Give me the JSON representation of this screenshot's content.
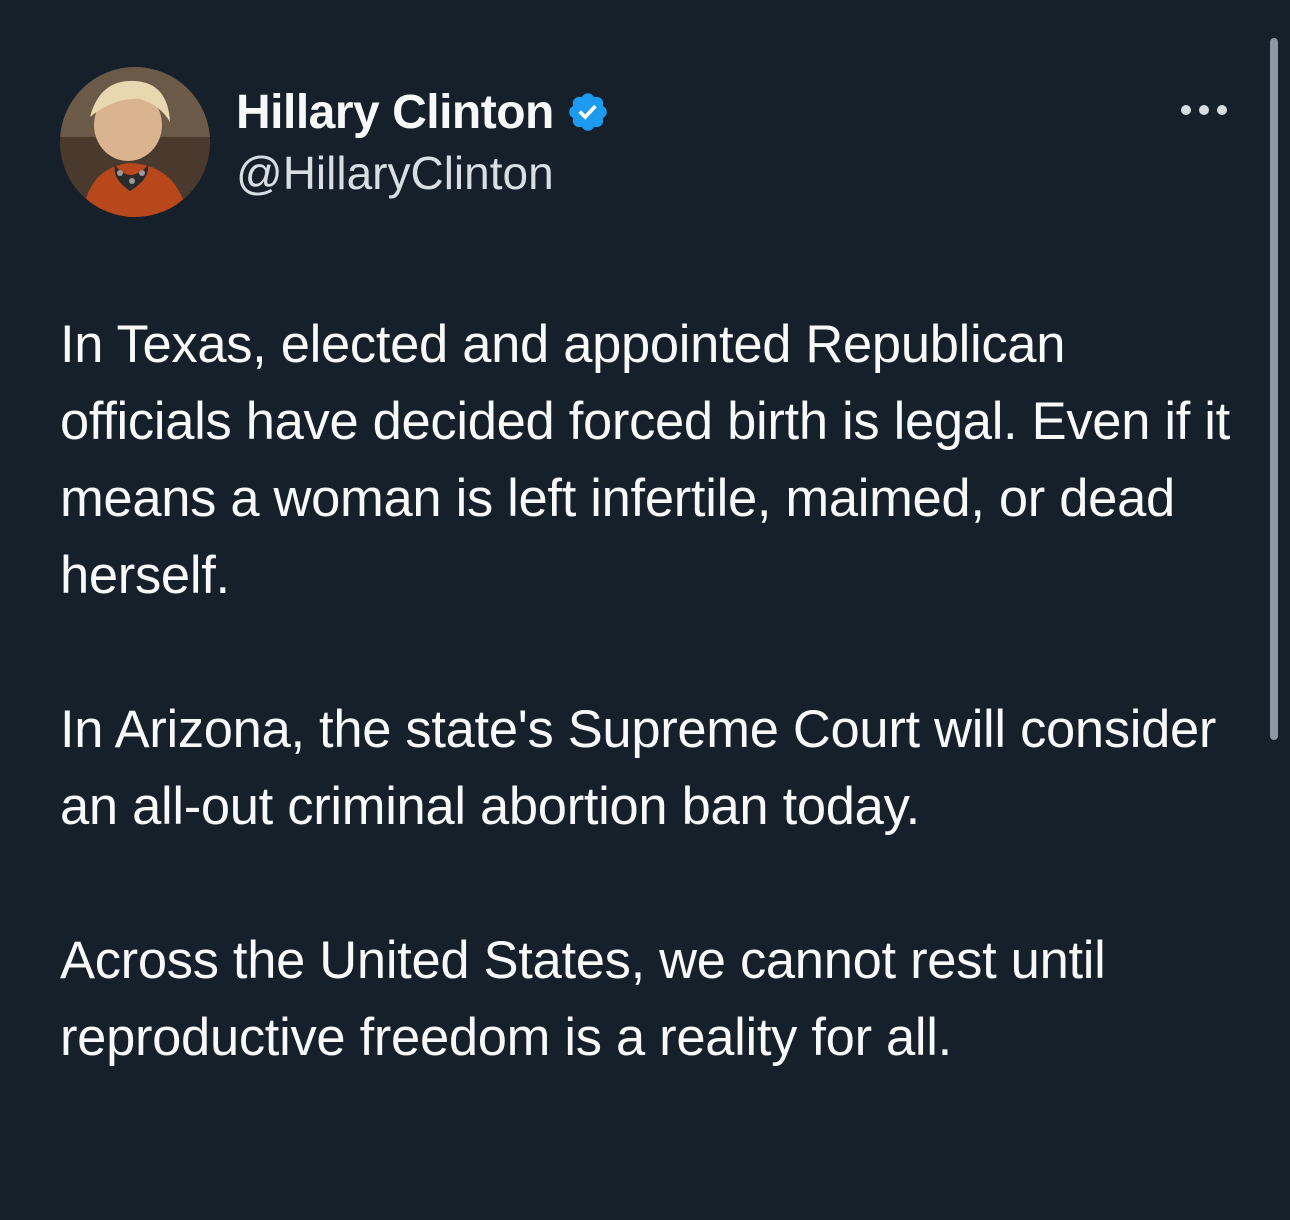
{
  "author": {
    "display_name": "Hillary Clinton",
    "handle": "@HillaryClinton",
    "verified": true
  },
  "icons": {
    "verified": "verified-badge-icon",
    "more": "more-options-icon"
  },
  "tweet": {
    "paragraphs": [
      "In Texas, elected and appointed Republican officials have decided forced birth is legal. Even if it means a woman is left infertile, maimed, or dead herself.",
      "In Arizona, the state's Supreme Court will consider an all-out criminal abortion ban today.",
      "Across the United States, we cannot rest until reproductive freedom is a reality for all."
    ]
  },
  "colors": {
    "background": "#15202b",
    "text": "#f7f9f9",
    "secondary_text": "#d9dee3",
    "verified_blue": "#1d9bf0",
    "scrollbar": "#8b98a5"
  }
}
